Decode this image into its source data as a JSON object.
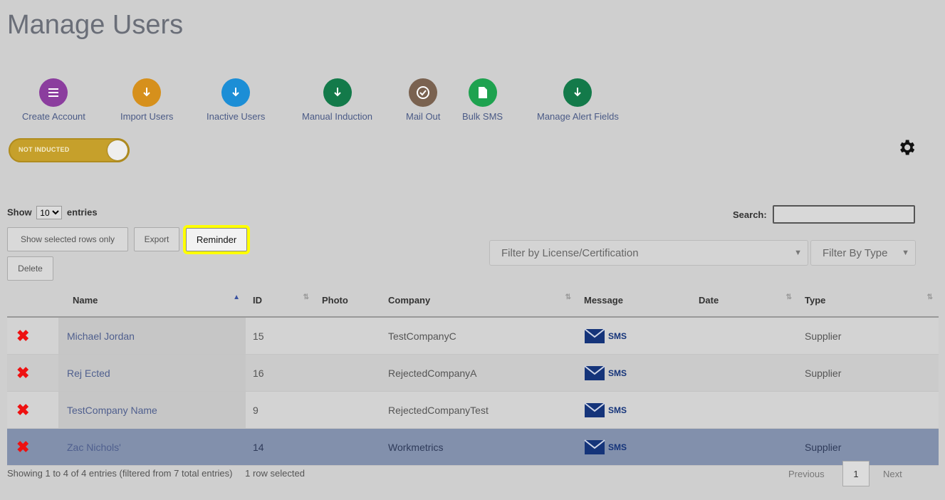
{
  "page": {
    "title": "Manage Users"
  },
  "actions": [
    {
      "label": "Create Account",
      "icon": "list-icon",
      "color": "#8b3d9e"
    },
    {
      "label": "Import Users",
      "icon": "download-icon",
      "color": "#d6901c"
    },
    {
      "label": "Inactive Users",
      "icon": "download-icon",
      "color": "#1c8ed6"
    },
    {
      "label": "Manual Induction",
      "icon": "download-icon",
      "color": "#137a4a"
    },
    {
      "label": "Mail Out",
      "icon": "check-circle-icon",
      "color": "#7a6250"
    },
    {
      "label": "Bulk SMS",
      "icon": "document-icon",
      "color": "#1ea24f"
    },
    {
      "label": "Manage Alert Fields",
      "icon": "download-icon",
      "color": "#137a4a"
    }
  ],
  "toggle": {
    "label": "NOT INDUCTED",
    "color": "#c6a02b"
  },
  "length": {
    "prefix": "Show",
    "value": "10",
    "suffix": "entries"
  },
  "search": {
    "label": "Search:",
    "value": ""
  },
  "buttons": {
    "show_selected": "Show selected rows only",
    "export": "Export",
    "reminder": "Reminder",
    "delete": "Delete"
  },
  "filters": {
    "license": "Filter by License/Certification",
    "type": "Filter By Type"
  },
  "table": {
    "columns": [
      "",
      "Name",
      "ID",
      "Photo",
      "Company",
      "Message",
      "Date",
      "Type"
    ],
    "rows": [
      {
        "name": "Michael Jordan",
        "id": "15",
        "photo": "",
        "company": "TestCompanyC",
        "message": "SMS",
        "date": "",
        "type": "Supplier",
        "selected": false
      },
      {
        "name": "Rej Ected",
        "id": "16",
        "photo": "",
        "company": "RejectedCompanyA",
        "message": "SMS",
        "date": "",
        "type": "Supplier",
        "selected": false
      },
      {
        "name": "TestCompany Name",
        "id": "9",
        "photo": "",
        "company": "RejectedCompanyTest",
        "message": "SMS",
        "date": "",
        "type": "",
        "selected": false
      },
      {
        "name": "Zac Nichols'",
        "id": "14",
        "photo": "",
        "company": "Workmetrics",
        "message": "SMS",
        "date": "",
        "type": "Supplier",
        "selected": true
      }
    ]
  },
  "footer": {
    "info": "Showing 1 to 4 of 4 entries (filtered from 7 total entries)",
    "selected": "1 row selected",
    "previous": "Previous",
    "page": "1",
    "next": "Next"
  },
  "colors": {
    "highlight": "#ffff00",
    "selected_row": "#8290ac",
    "delete_x": "#e11111"
  }
}
